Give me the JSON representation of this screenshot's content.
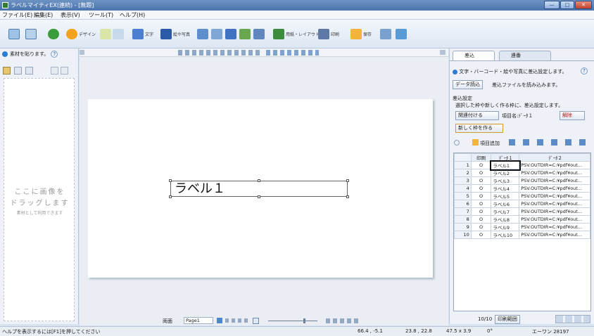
{
  "window": {
    "title": "ラベルマイティEX(連続) - [無題]",
    "minimize": "—",
    "maximize": "□",
    "close": "✕"
  },
  "menu": [
    "ファイル(E)",
    "編集(E)",
    "表示(V)",
    "ツール(T)",
    "ヘルプ(H)"
  ],
  "toolbar": {
    "design": "デザイン",
    "text": "文字",
    "image": "絵や写真",
    "paper_layout": "用紙・レイアウト",
    "print": "印刷",
    "save": "保存"
  },
  "left_panel": {
    "header": "素材を貼ります。",
    "help": "?",
    "drop_line1": "ここに画像を",
    "drop_line2": "ドラッグします",
    "drop_line3": "素材として利用できます"
  },
  "canvas": {
    "label_text": "ラベル１",
    "page_mode": "両面",
    "page_name": "Page1"
  },
  "right_panel": {
    "tab_merge": "差込",
    "tab_serial": "連番",
    "info": "文字・バーコード・絵や写真に差込設定します。",
    "help": "?",
    "load_data_button": "データ読込",
    "load_data_desc": "差込ファイルを読み込みます。",
    "setting_title": "差込設定",
    "setting_desc": "選択した枠や新しく作る枠に、差込設定します。",
    "link_button": "関連付ける",
    "field_label": "項目名:ﾃﾞｰﾀ１",
    "unlink_button": "解除",
    "new_frame_button": "新しく枠を作る",
    "add_field": "項目追加",
    "col_print": "印刷",
    "col_data1": "ﾃﾞｰﾀ１",
    "col_data2": "ﾃﾞｰﾀ２",
    "rows": [
      {
        "n": "1",
        "mark": "O",
        "d1": "ラベル1",
        "d2": "PSV.OUTDIR=C:¥pdf¥out..."
      },
      {
        "n": "2",
        "mark": "O",
        "d1": "ラベル2",
        "d2": "PSV.OUTDIR=C:¥pdf¥out..."
      },
      {
        "n": "3",
        "mark": "O",
        "d1": "ラベル3",
        "d2": "PSV.OUTDIR=C:¥pdf¥out..."
      },
      {
        "n": "4",
        "mark": "O",
        "d1": "ラベル4",
        "d2": "PSV.OUTDIR=C:¥pdf¥out..."
      },
      {
        "n": "5",
        "mark": "O",
        "d1": "ラベル5",
        "d2": "PSV.OUTDIR=C:¥pdf¥out..."
      },
      {
        "n": "6",
        "mark": "O",
        "d1": "ラベル6",
        "d2": "PSV.OUTDIR=C:¥pdf¥out..."
      },
      {
        "n": "7",
        "mark": "O",
        "d1": "ラベル7",
        "d2": "PSV.OUTDIR=C:¥pdf¥out..."
      },
      {
        "n": "8",
        "mark": "O",
        "d1": "ラベル8",
        "d2": "PSV.OUTDIR=C:¥pdf¥out..."
      },
      {
        "n": "9",
        "mark": "O",
        "d1": "ラベル9",
        "d2": "PSV.OUTDIR=C:¥pdf¥out..."
      },
      {
        "n": "10",
        "mark": "O",
        "d1": "ラベル10",
        "d2": "PSV.OUTDIR=C:¥pdf¥out..."
      }
    ],
    "record_count": "10/10",
    "print_range_button": "印刷範囲"
  },
  "status": {
    "hint": "ヘルプを表示するには[F1]を押してください",
    "cursor": "66.4 , -5.1",
    "position": "23.8 , 22.8",
    "size": "47.5 x 3.9",
    "rotation": "0°",
    "error_code": "エーワン 28197"
  },
  "colors": {
    "accent": "#4a74ad",
    "toolbar_orange": "#f2a21e"
  }
}
